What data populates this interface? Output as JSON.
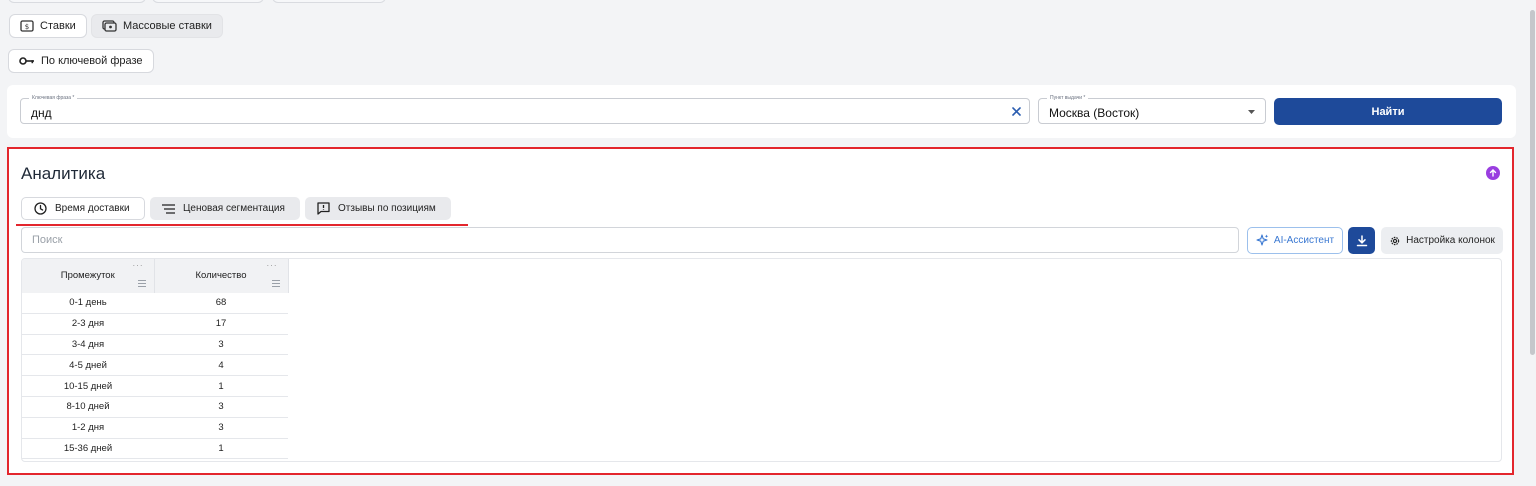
{
  "mode_tabs": [
    {
      "label": "Ставки",
      "icon": "dollar-icon"
    },
    {
      "label": "Массовые ставки",
      "icon": "bids-icon"
    }
  ],
  "search_type": {
    "label": "По ключевой фразе",
    "icon": "key-icon"
  },
  "search_form": {
    "keyword_label": "Ключевая фраза *",
    "keyword_value": "днд",
    "pickup_label": "Пункт выдачи *",
    "pickup_value": "Москва (Восток)",
    "find_button": "Найти"
  },
  "analytics": {
    "title": "Аналитика",
    "tabs": [
      {
        "label": "Время доставки",
        "icon": "clock-icon",
        "active": true
      },
      {
        "label": "Ценовая сегментация",
        "icon": "filter-lines-icon",
        "active": false
      },
      {
        "label": "Отзывы по позициям",
        "icon": "review-icon",
        "active": false
      }
    ],
    "search_placeholder": "Поиск",
    "ai_button": "AI-Ассистент",
    "columns_button": "Настройка колонок",
    "table": {
      "headers": [
        "Промежуток",
        "Количество"
      ],
      "rows": [
        [
          "0-1 день",
          "68"
        ],
        [
          "2-3 дня",
          "17"
        ],
        [
          "3-4 дня",
          "3"
        ],
        [
          "4-5 дней",
          "4"
        ],
        [
          "10-15 дней",
          "1"
        ],
        [
          "8-10 дней",
          "3"
        ],
        [
          "1-2 дня",
          "3"
        ],
        [
          "15-36 дней",
          "1"
        ]
      ]
    }
  },
  "colors": {
    "primary": "#1e4a9a",
    "highlight": "#e3262d",
    "accent_purple": "#9a3ee0",
    "ai_blue": "#3a78d2"
  }
}
